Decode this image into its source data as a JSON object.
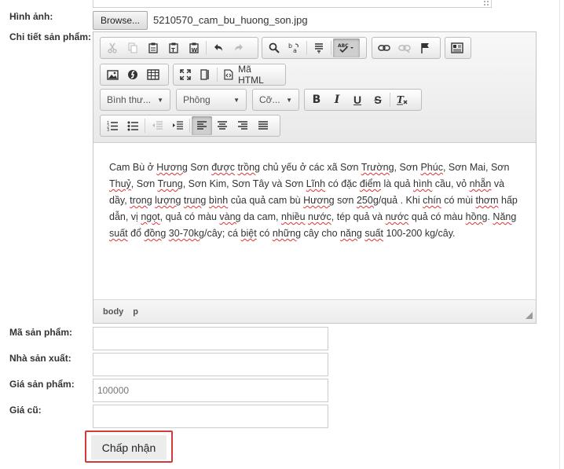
{
  "form": {
    "image_label": "Hình ảnh:",
    "browse_label": "Browse...",
    "file_name": "5210570_cam_bu_huong_son.jpg",
    "detail_label": "Chi tiết sản phẩm:",
    "code_label": "Mã sản phẩm:",
    "maker_label": "Nhà sản xuất:",
    "price_label": "Giá sản phẩm:",
    "price_placeholder": "100000",
    "old_price_label": "Giá cũ:",
    "submit_label": "Chấp nhận"
  },
  "editor": {
    "combos": {
      "format": "Bình thư...",
      "font": "Phông",
      "size": "Cỡ..."
    },
    "source_label": "Mã HTML",
    "content": [
      {
        "t": "Cam Bù ở "
      },
      {
        "t": "Hương",
        "s": true
      },
      {
        "t": " Sơn "
      },
      {
        "t": "được",
        "s": true
      },
      {
        "t": " "
      },
      {
        "t": "trồng",
        "s": true
      },
      {
        "t": " chủ yếu ở các xã Sơn "
      },
      {
        "t": "Trường",
        "s": true
      },
      {
        "t": ", Sơn "
      },
      {
        "t": "Phúc",
        "s": true
      },
      {
        "t": ", Sơn Mai, Sơn "
      },
      {
        "t": "Thuỷ",
        "s": true
      },
      {
        "t": ", Sơn "
      },
      {
        "t": "Trung",
        "s": true
      },
      {
        "t": ", Sơn Kim, Sơn Tây và Sơn "
      },
      {
        "t": "Lĩnh",
        "s": true
      },
      {
        "t": " có đặc "
      },
      {
        "t": "điểm",
        "s": true
      },
      {
        "t": " là quả "
      },
      {
        "t": "hình",
        "s": true
      },
      {
        "t": " cầu, vỏ "
      },
      {
        "t": "nhẵn",
        "s": true
      },
      {
        "t": " và dầy, "
      },
      {
        "t": "trong",
        "s": true
      },
      {
        "t": " "
      },
      {
        "t": "lượng",
        "s": true
      },
      {
        "t": " "
      },
      {
        "t": "trung",
        "s": true
      },
      {
        "t": " "
      },
      {
        "t": "bình",
        "s": true
      },
      {
        "t": " của quả cam bù "
      },
      {
        "t": "Hương",
        "s": true
      },
      {
        "t": " sơn "
      },
      {
        "t": "250g",
        "s": true
      },
      {
        "t": "/quả . Khi "
      },
      {
        "t": "chín",
        "s": true
      },
      {
        "t": " có mùi "
      },
      {
        "t": "thơm",
        "s": true
      },
      {
        "t": " hấp dẫn, vị "
      },
      {
        "t": "ngọt",
        "s": true
      },
      {
        "t": ", quả có màu "
      },
      {
        "t": "vàng",
        "s": true
      },
      {
        "t": " da cam, "
      },
      {
        "t": "nhiều",
        "s": true
      },
      {
        "t": " "
      },
      {
        "t": "nước",
        "s": true
      },
      {
        "t": ", tép quả và "
      },
      {
        "t": "nước",
        "s": true
      },
      {
        "t": " quả có màu "
      },
      {
        "t": "hồng",
        "s": true
      },
      {
        "t": ". "
      },
      {
        "t": "Năng",
        "s": true
      },
      {
        "t": " "
      },
      {
        "t": "suất",
        "s": true
      },
      {
        "t": " đổ "
      },
      {
        "t": "đồng",
        "s": true
      },
      {
        "t": " "
      },
      {
        "t": "30-70kg",
        "s": true
      },
      {
        "t": "/cây; cá "
      },
      {
        "t": "biệt",
        "s": true
      },
      {
        "t": " có "
      },
      {
        "t": "những",
        "s": true
      },
      {
        "t": " cây cho "
      },
      {
        "t": "năng",
        "s": true
      },
      {
        "t": " "
      },
      {
        "t": "suất",
        "s": true
      },
      {
        "t": " 100-200 kg/cây."
      }
    ],
    "path": [
      "body",
      "p"
    ]
  }
}
